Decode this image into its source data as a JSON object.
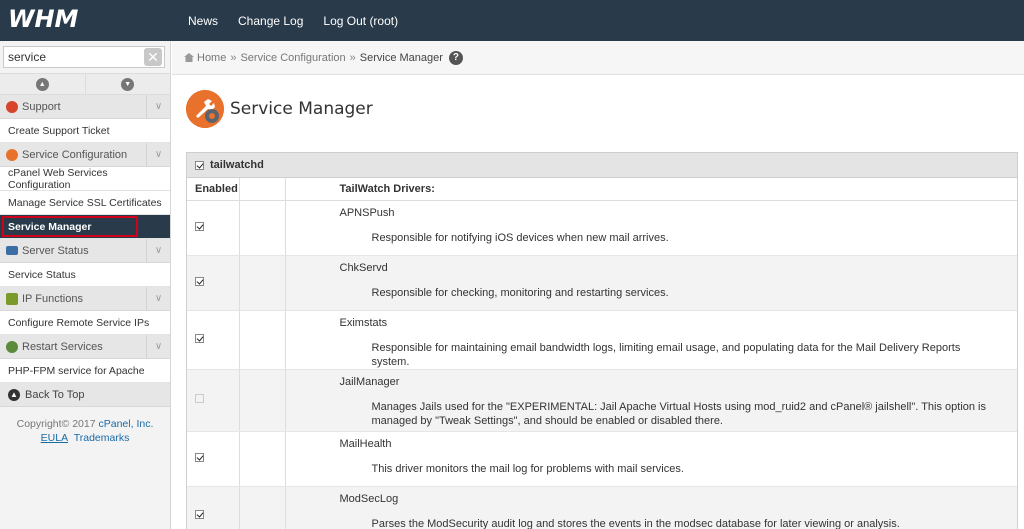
{
  "app": {
    "logo_text": "WHM"
  },
  "topnav": {
    "news": "News",
    "changelog": "Change Log",
    "logout": "Log Out (root)"
  },
  "sidebar": {
    "search_value": "service",
    "clear_label": "✕",
    "categories": [
      {
        "label": "Support",
        "icon_color": "#d8432c",
        "items": [
          "Create Support Ticket"
        ]
      },
      {
        "label": "Service Configuration",
        "icon_color": "#e8722c",
        "items": [
          "cPanel Web Services Configuration",
          "Manage Service SSL Certificates",
          "Service Manager"
        ]
      },
      {
        "label": "Server Status",
        "icon_color": "#3a6ea5",
        "items": [
          "Service Status"
        ]
      },
      {
        "label": "IP Functions",
        "icon_color": "#7a9a2a",
        "items": [
          "Configure Remote Service IPs"
        ]
      },
      {
        "label": "Restart Services",
        "icon_color": "#5a8a3a",
        "items": [
          "PHP-FPM service for Apache"
        ]
      }
    ],
    "back_to_top": "Back To Top",
    "copyright_prefix": "Copyright© 2017",
    "copyright_link": "cPanel, Inc.",
    "eula": "EULA",
    "trademarks": "Trademarks"
  },
  "breadcrumb": {
    "home": "Home",
    "section": "Service Configuration",
    "current": "Service Manager",
    "sep": "»",
    "help": "?"
  },
  "page": {
    "title": "Service Manager"
  },
  "panel": {
    "service_name": "tailwatchd",
    "service_checked": true,
    "col_enabled": "Enabled",
    "col_drivers": "TailWatch Drivers:",
    "drivers": [
      {
        "name": "APNSPush",
        "desc": "Responsible for notifying iOS devices when new mail arrives.",
        "enabled": true,
        "disabled": false
      },
      {
        "name": "ChkServd",
        "desc": "Responsible for checking, monitoring and restarting services.",
        "enabled": true,
        "disabled": false
      },
      {
        "name": "Eximstats",
        "desc": "Responsible for maintaining email bandwidth logs, limiting email usage, and populating data for the Mail Delivery Reports system.",
        "enabled": true,
        "disabled": false
      },
      {
        "name": "JailManager",
        "desc": "Manages Jails used for the \"EXPERIMENTAL: Jail Apache Virtual Hosts using mod_ruid2 and cPanel® jailshell\". This option is managed by \"Tweak Settings\", and should be enabled or disabled there.",
        "enabled": false,
        "disabled": true
      },
      {
        "name": "MailHealth",
        "desc": "This driver monitors the mail log for problems with mail services.",
        "enabled": true,
        "disabled": false
      },
      {
        "name": "ModSecLog",
        "desc": "Parses the ModSecurity audit log and stores the events in the modsec database for later viewing or analysis.",
        "enabled": true,
        "disabled": false
      }
    ]
  }
}
